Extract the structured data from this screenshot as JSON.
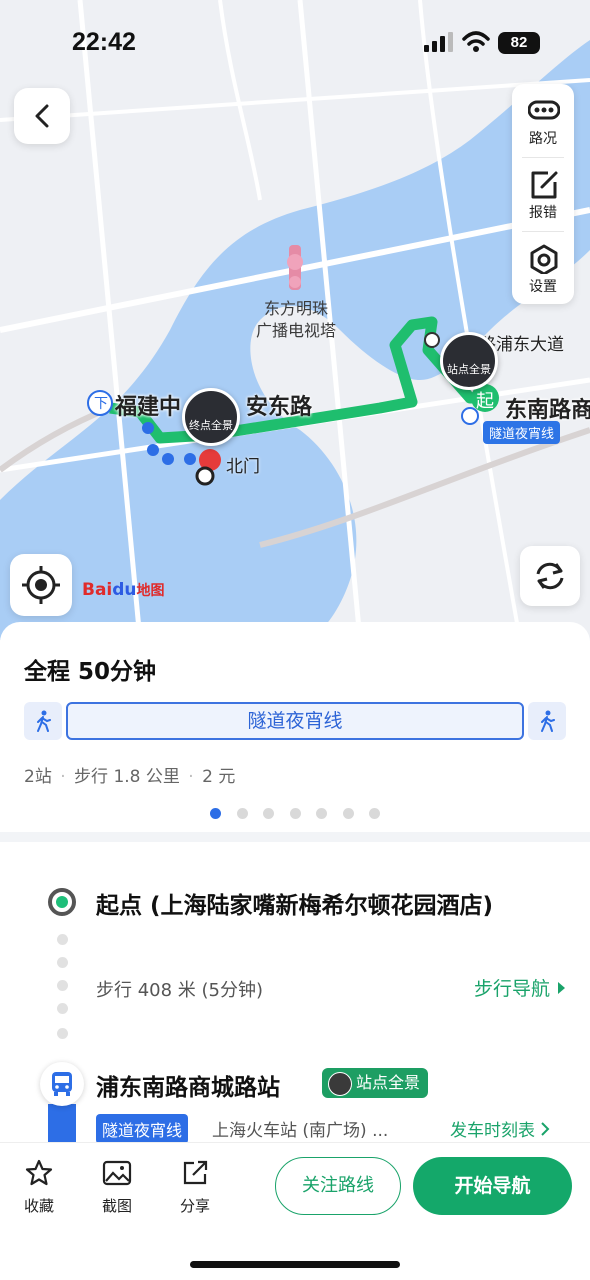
{
  "status": {
    "time": "22:42",
    "battery": "82"
  },
  "map": {
    "tools": [
      {
        "label": "路况",
        "icon": "traffic-icon"
      },
      {
        "label": "报错",
        "icon": "edit-report-icon"
      },
      {
        "label": "设置",
        "icon": "settings-icon"
      }
    ],
    "landmark": {
      "line1": "东方明珠",
      "line2": "广播电视塔"
    },
    "road_left": "福建中",
    "road_left_2": "安东路",
    "road_right": "东南路商",
    "road_top_right": "南路浦东大道",
    "north_gate": "北门",
    "end_pano": "终点全景",
    "station_pano": "站点全景",
    "start_marker": "起",
    "down_marker": "下",
    "route_tag": "隧道夜宵线",
    "logo_a": "Bai",
    "logo_b": "du",
    "logo_c": "地图",
    "colors": {
      "route": "#1fbe6e",
      "river": "#a9cdf5",
      "accent": "#2d6ee6"
    }
  },
  "summary": {
    "total": "全程 50分钟",
    "line": "隧道夜宵线",
    "stops": "2站",
    "walk": "步行 1.8 公里",
    "fare": "2 元",
    "sep": "·",
    "pages": 7,
    "active_page": 1
  },
  "steps": {
    "start": "起点 (上海陆家嘴新梅希尔顿花园酒店)",
    "walk": "步行 408 米 (5分钟)",
    "walk_nav": "步行导航",
    "stop": "浦东南路商城路站",
    "stop_pano": "站点全景",
    "line_tag": "隧道夜宵线",
    "direction": "上海火车站 (南广场) ...",
    "timetable": "发车时刻表"
  },
  "bottom": {
    "favorite": "收藏",
    "screenshot": "截图",
    "share": "分享",
    "follow": "关注路线",
    "navigate": "开始导航"
  }
}
